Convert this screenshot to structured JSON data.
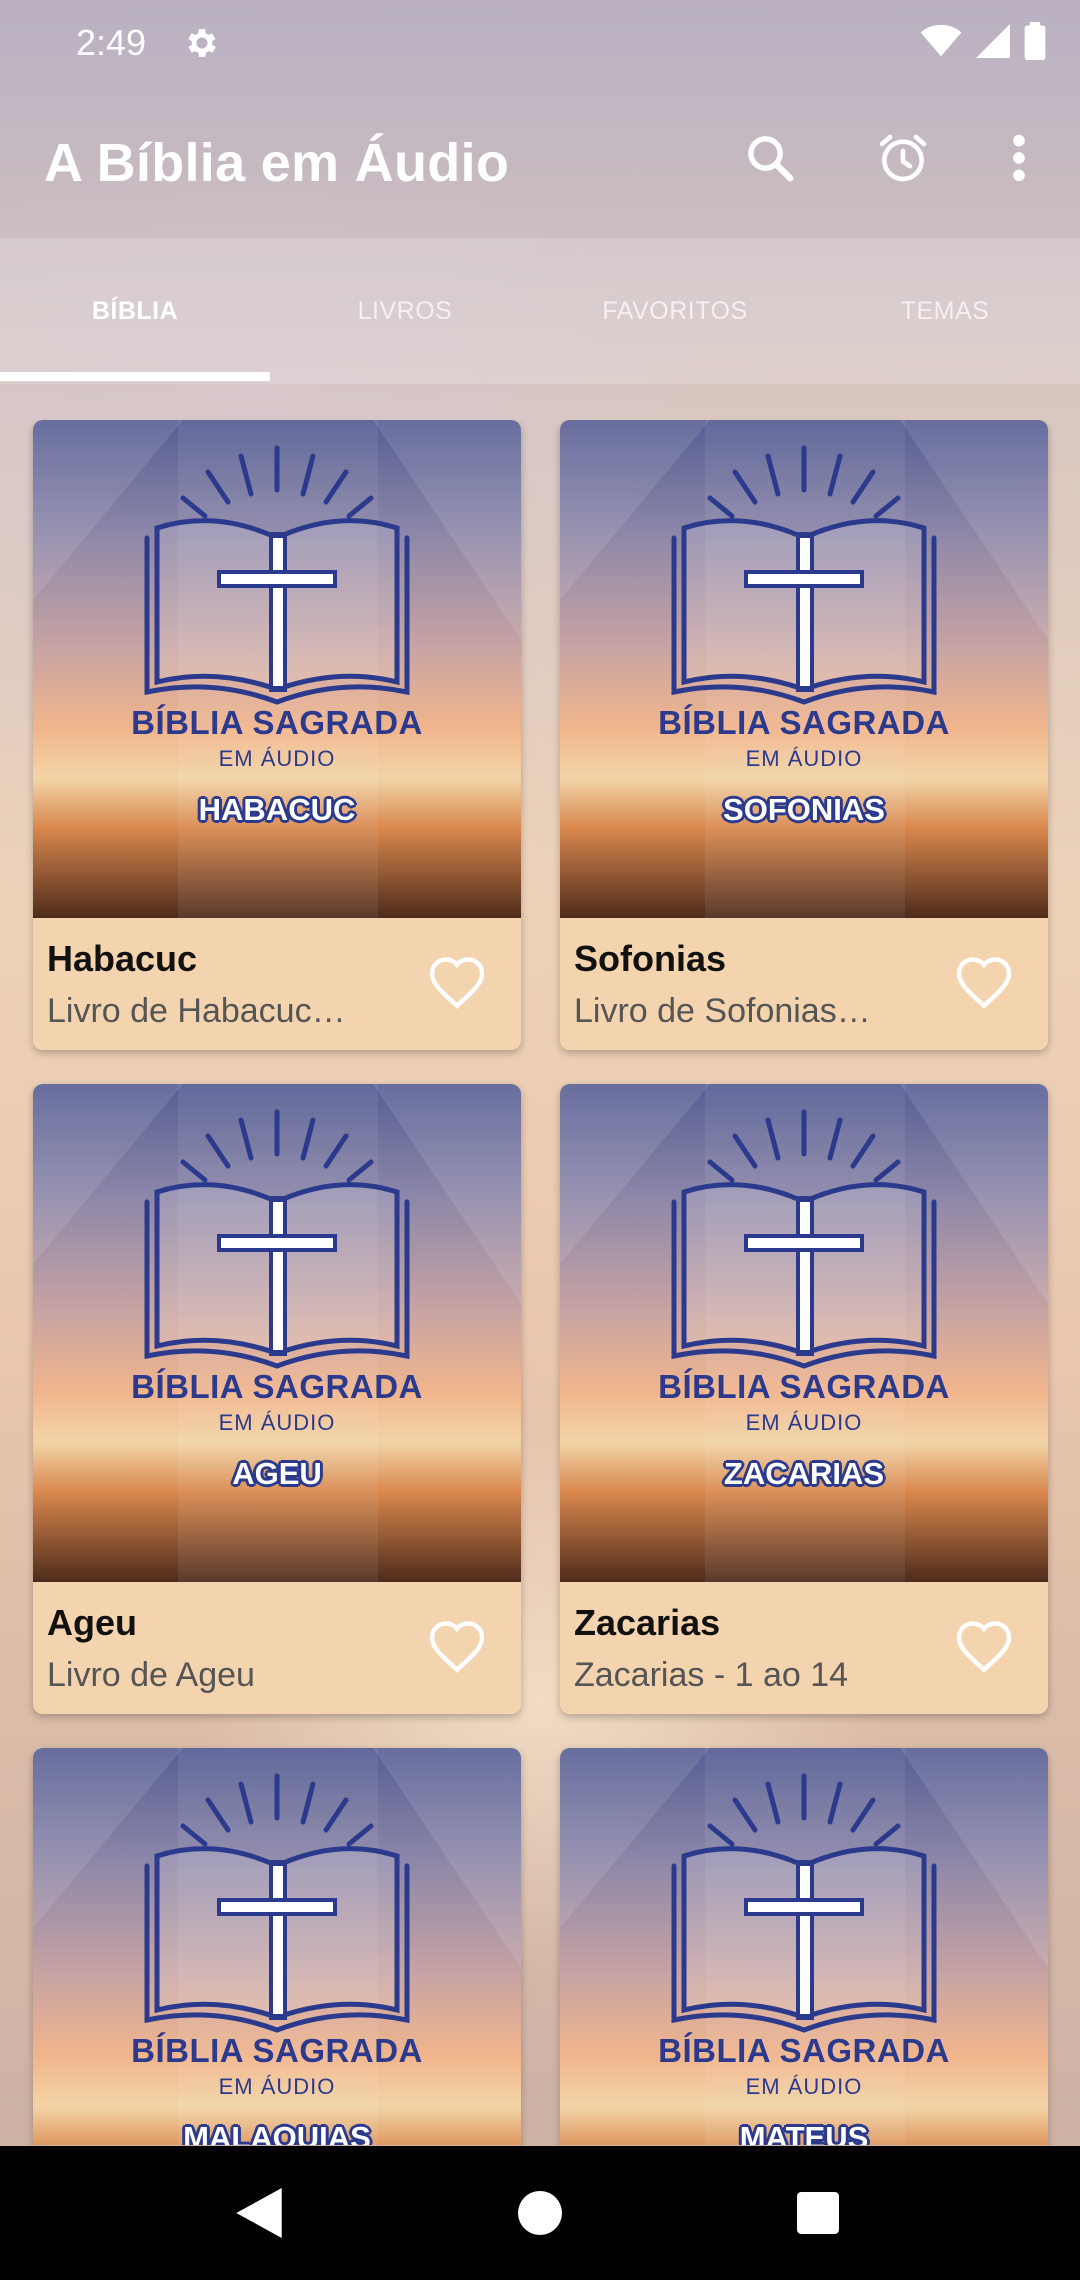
{
  "status_bar": {
    "time": "2:49",
    "icons": [
      "gear-icon",
      "wifi-icon",
      "signal-icon",
      "battery-icon"
    ]
  },
  "app_bar": {
    "title": "A Bíblia em Áudio",
    "actions": [
      "search-icon",
      "alarm-icon",
      "more-vert-icon"
    ]
  },
  "tabs": [
    {
      "label": "BÍBLIA",
      "active": true
    },
    {
      "label": "LIVROS",
      "active": false
    },
    {
      "label": "FAVORITOS",
      "active": false
    },
    {
      "label": "TEMAS",
      "active": false
    }
  ],
  "cover": {
    "title": "BÍBLIA SAGRADA",
    "subtitle": "EM ÁUDIO"
  },
  "cards": [
    {
      "title": "Habacuc",
      "subtitle": "Livro de Habacuc…",
      "book_label": "HABACUC"
    },
    {
      "title": "Sofonias",
      "subtitle": "Livro de Sofonias…",
      "book_label": "SOFONIAS"
    },
    {
      "title": "Ageu",
      "subtitle": "Livro de Ageu",
      "book_label": "AGEU"
    },
    {
      "title": "Zacarias",
      "subtitle": "Zacarias - 1 ao 14",
      "book_label": "ZACARIAS"
    },
    {
      "title": "",
      "subtitle": "",
      "book_label": "MALAQUIAS"
    },
    {
      "title": "",
      "subtitle": "",
      "book_label": "MATEUS"
    }
  ],
  "colors": {
    "card_footer": "#f4d4ae",
    "cover_blue": "#2b3a8c",
    "nav_bar": "#000000"
  },
  "nav_bar": {
    "buttons": [
      "back-icon",
      "home-icon",
      "recents-icon"
    ]
  }
}
